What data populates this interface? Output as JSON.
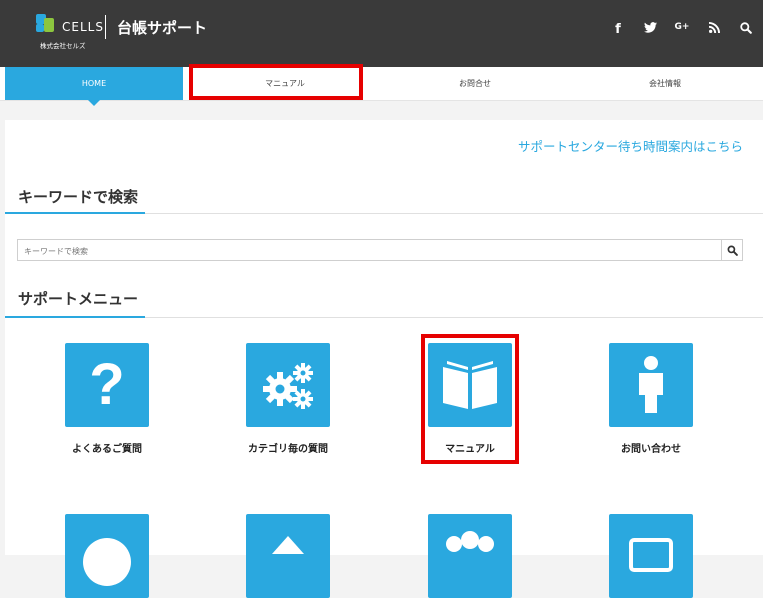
{
  "header": {
    "brand": "CELLS",
    "company": "株式会社セルズ",
    "site_title": "台帳サポート",
    "social": [
      "f",
      "🐦",
      "G+",
      "RSS",
      "search"
    ]
  },
  "nav": {
    "items": [
      {
        "label": "HOME",
        "active": true
      },
      {
        "label": "マニュアル",
        "active": false
      },
      {
        "label": "お問合せ",
        "active": false
      },
      {
        "label": "会社情報",
        "active": false
      }
    ]
  },
  "main": {
    "wait_link": "サポートセンター待ち時間案内はこちら",
    "search_section_title": "キーワードで検索",
    "search_placeholder": "キーワードで検索",
    "menu_section_title": "サポートメニュー",
    "menu": [
      {
        "label": "よくあるご質問",
        "icon": "question-icon"
      },
      {
        "label": "カテゴリ毎の質問",
        "icon": "gears-icon"
      },
      {
        "label": "マニュアル",
        "icon": "book-icon"
      },
      {
        "label": "お問い合わせ",
        "icon": "person-icon"
      }
    ]
  },
  "colors": {
    "accent": "#2aa8df",
    "header_bg": "#3a3a3a",
    "highlight": "#e60000"
  }
}
